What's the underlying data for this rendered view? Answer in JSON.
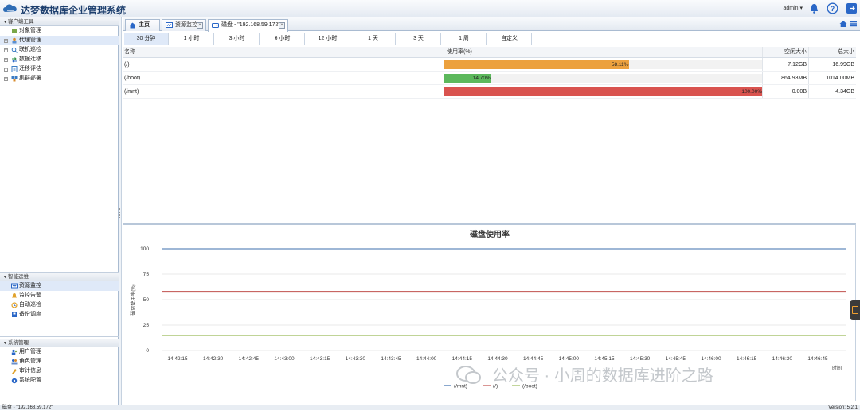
{
  "app": {
    "title": "达梦数据库企业管理系统",
    "user": "admin ▾"
  },
  "sidebar": {
    "panels": [
      {
        "title": "客户端工具",
        "items": [
          {
            "label": "对象管理",
            "icon": "object-icon",
            "expandable": false,
            "selected": false
          },
          {
            "label": "代理管理",
            "icon": "agent-icon",
            "expandable": true,
            "selected": true
          },
          {
            "label": "联机巡检",
            "icon": "inspect-icon",
            "expandable": true,
            "selected": false
          },
          {
            "label": "数据迁移",
            "icon": "migrate-icon",
            "expandable": true,
            "selected": false
          },
          {
            "label": "迁移评估",
            "icon": "evaluate-icon",
            "expandable": true,
            "selected": false
          },
          {
            "label": "集群部署",
            "icon": "cluster-icon",
            "expandable": true,
            "selected": false
          }
        ]
      },
      {
        "title": "智能运维",
        "items": [
          {
            "label": "资源监控",
            "icon": "monitor-icon",
            "expandable": false,
            "selected": true
          },
          {
            "label": "监控告警",
            "icon": "alarm-icon",
            "expandable": false,
            "selected": false
          },
          {
            "label": "自动巡检",
            "icon": "auto-inspect-icon",
            "expandable": false,
            "selected": false
          },
          {
            "label": "备份调度",
            "icon": "backup-icon",
            "expandable": false,
            "selected": false
          }
        ]
      },
      {
        "title": "系统管理",
        "items": [
          {
            "label": "用户管理",
            "icon": "user-icon",
            "expandable": false,
            "selected": false
          },
          {
            "label": "角色管理",
            "icon": "role-icon",
            "expandable": false,
            "selected": false
          },
          {
            "label": "审计信息",
            "icon": "audit-icon",
            "expandable": false,
            "selected": false
          },
          {
            "label": "系统配置",
            "icon": "config-icon",
            "expandable": false,
            "selected": false
          }
        ]
      }
    ]
  },
  "tabs": [
    {
      "label": "主页",
      "closable": false,
      "active": false
    },
    {
      "label": "资源监控",
      "closable": true,
      "active": false
    },
    {
      "label": "磁盘 - \"192.168.59.172\"",
      "closable": true,
      "active": true
    }
  ],
  "ranges": [
    {
      "label": "30 分钟",
      "active": true
    },
    {
      "label": "1 小时",
      "active": false
    },
    {
      "label": "3 小时",
      "active": false
    },
    {
      "label": "6 小时",
      "active": false
    },
    {
      "label": "12 小时",
      "active": false
    },
    {
      "label": "1 天",
      "active": false
    },
    {
      "label": "3 天",
      "active": false
    },
    {
      "label": "1 周",
      "active": false
    },
    {
      "label": "自定义",
      "active": false
    }
  ],
  "disk_table": {
    "headers": {
      "name": "名称",
      "usage": "使用率(%)",
      "free": "空闲大小",
      "total": "总大小"
    },
    "rows": [
      {
        "name": "(/)",
        "usage": 58.11,
        "usage_label": "58.11%",
        "free": "7.12GB",
        "total": "16.99GB",
        "color": "#eca13e"
      },
      {
        "name": "(/boot)",
        "usage": 14.7,
        "usage_label": "14.70%",
        "free": "864.93MB",
        "total": "1014.00MB",
        "color": "#5cb85c"
      },
      {
        "name": "(/mnt)",
        "usage": 100.0,
        "usage_label": "100.00%",
        "free": "0.00B",
        "total": "4.34GB",
        "color": "#d9534f"
      }
    ]
  },
  "chart_data": {
    "type": "line",
    "title": "磁盘使用率",
    "ylabel": "磁盘使用率(%)",
    "xlabel": "时间",
    "ylim": [
      0,
      100
    ],
    "yticks": [
      0,
      25,
      50,
      75,
      100
    ],
    "x": [
      "14:42:15",
      "14:42:30",
      "14:42:45",
      "14:43:00",
      "14:43:15",
      "14:43:30",
      "14:43:45",
      "14:44:00",
      "14:44:15",
      "14:44:30",
      "14:44:45",
      "14:45:00",
      "14:45:15",
      "14:45:30",
      "14:45:45",
      "14:46:00",
      "14:46:15",
      "14:46:30",
      "14:46:45"
    ],
    "grid": true,
    "legend_position": "bottom",
    "series": [
      {
        "name": "(/mnt)",
        "color": "#3d6fae",
        "values": [
          100,
          100,
          100,
          100,
          100,
          100,
          100,
          100,
          100,
          100,
          100,
          100,
          100,
          100,
          100,
          100,
          100,
          100,
          100
        ]
      },
      {
        "name": "(/)",
        "color": "#c0504d",
        "values": [
          58.11,
          58.11,
          58.11,
          58.11,
          58.11,
          58.11,
          58.11,
          58.11,
          58.11,
          58.11,
          58.11,
          58.11,
          58.11,
          58.11,
          58.11,
          58.11,
          58.11,
          58.11,
          58.11
        ]
      },
      {
        "name": "(/boot)",
        "color": "#9bbb59",
        "values": [
          14.7,
          14.7,
          14.7,
          14.7,
          14.7,
          14.7,
          14.7,
          14.7,
          14.7,
          14.7,
          14.7,
          14.7,
          14.7,
          14.7,
          14.7,
          14.7,
          14.7,
          14.7,
          14.7
        ]
      }
    ]
  },
  "watermark": "公众号 · 小周的数据库进阶之路",
  "status": {
    "left": "磁盘 - \"192.168.59.172\"",
    "right": "Version: 5.2.1"
  }
}
